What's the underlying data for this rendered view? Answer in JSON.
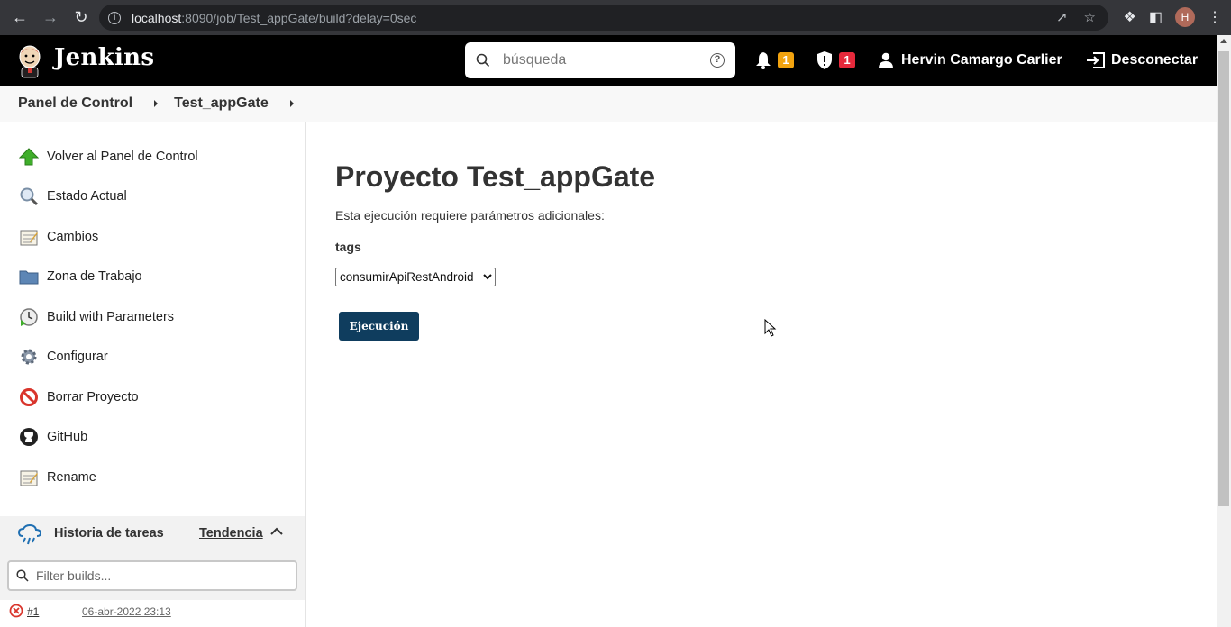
{
  "browser": {
    "url_host": "localhost",
    "url_rest": ":8090/job/Test_appGate/build?delay=0sec",
    "profile_initial": "H"
  },
  "header": {
    "brand": "Jenkins",
    "search_placeholder": "búsqueda",
    "notifications_count": "1",
    "security_count": "1",
    "user_name": "Hervin Camargo Carlier",
    "logout_label": "Desconectar",
    "colors": {
      "notify": "#f2a30f",
      "security": "#e6293b"
    }
  },
  "breadcrumb": {
    "items": [
      "Panel de Control",
      "Test_appGate"
    ]
  },
  "sidebar": {
    "items": [
      {
        "label": "Volver al Panel de Control",
        "icon": "up-arrow-icon"
      },
      {
        "label": "Estado Actual",
        "icon": "magnifier-icon"
      },
      {
        "label": "Cambios",
        "icon": "notepad-icon"
      },
      {
        "label": "Zona de Trabajo",
        "icon": "folder-icon"
      },
      {
        "label": "Build with Parameters",
        "icon": "clock-play-icon"
      },
      {
        "label": "Configurar",
        "icon": "gear-icon"
      },
      {
        "label": "Borrar Proyecto",
        "icon": "no-entry-icon"
      },
      {
        "label": "GitHub",
        "icon": "github-icon"
      },
      {
        "label": "Rename",
        "icon": "notepad-icon"
      }
    ],
    "history": {
      "title": "Historia de tareas",
      "trend": "Tendencia",
      "filter_placeholder": "Filter builds...",
      "builds": [
        {
          "number": "#1",
          "date": "06-abr-2022 23:13",
          "status": "failed"
        }
      ]
    }
  },
  "main": {
    "title": "Proyecto Test_appGate",
    "description": "Esta ejecución requiere parámetros adicionales:",
    "param_label": "tags",
    "param_selected": "consumirApiRestAndroid",
    "run_button": "Ejecución",
    "button_color": "#0f3d5e"
  }
}
